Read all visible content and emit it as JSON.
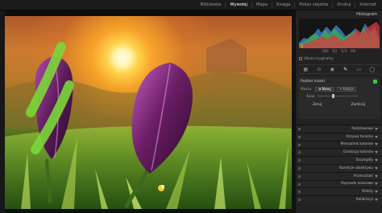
{
  "topbar": {
    "modules": [
      {
        "label": "Biblioteka",
        "active": false
      },
      {
        "label": "Wywołaj",
        "active": true
      },
      {
        "label": "Mapa",
        "active": false
      },
      {
        "label": "Księga",
        "active": false
      },
      {
        "label": "Pokaz slajdów",
        "active": false
      },
      {
        "label": "Drukuj",
        "active": false
      },
      {
        "label": "Internet",
        "active": false
      }
    ]
  },
  "panel": {
    "title": "Histogram",
    "readout": {
      "iso": "ISO",
      "ev": "f/2",
      "shutter": "1/3",
      "fstop": "f/8"
    },
    "show_original": "Obraz oryginalny",
    "tool_icons": [
      "crop-icon",
      "spot-heal-icon",
      "redeye-icon",
      "graduated-filter-icon",
      "radial-filter-icon",
      "brush-icon"
    ],
    "mask": {
      "title": "Pędzel maski",
      "toggle_color": "#39c44a",
      "row_label": "Maska",
      "seg_new": "Nowy",
      "seg_edit": "Edycja",
      "slider_label": "Kolor",
      "slider_value": "",
      "reset": "Zeruj",
      "close": "Zamknij"
    },
    "sections": [
      "Podstawowe",
      "Krzywa tonalna",
      "Mieszalnik kolorów",
      "Gradacja kolorów",
      "Szczegóły",
      "Korekcje obiektywu",
      "Przekształć",
      "Poprawki kolorowe",
      "Efekty",
      "Kalibracja"
    ]
  },
  "colors": {
    "accent_green": "#39c44a",
    "mask_overlay": "#7bd63a",
    "flower_purple": "#5a1b58"
  }
}
